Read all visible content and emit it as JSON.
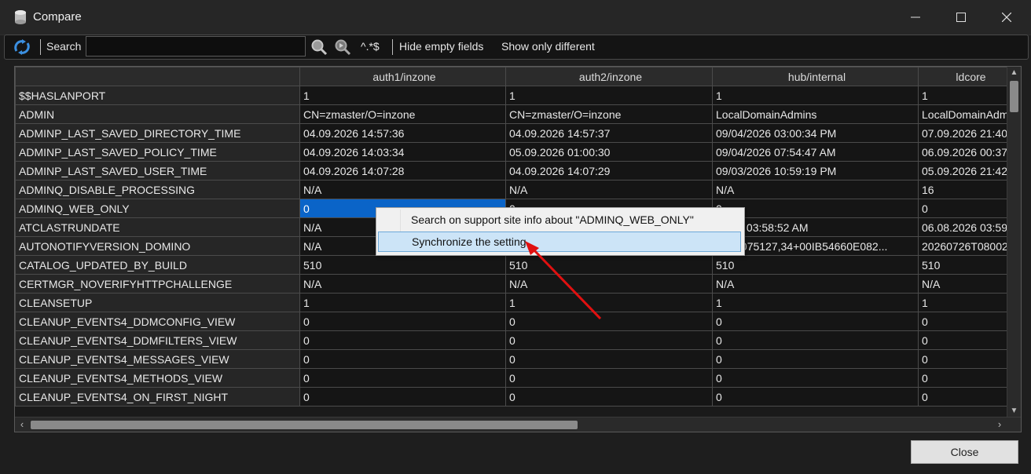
{
  "window": {
    "title": "Compare"
  },
  "toolbar": {
    "search_label": "Search",
    "search_value": "",
    "regex_label": "^.*$",
    "hide_empty_label": "Hide empty fields",
    "show_different_label": "Show only different"
  },
  "grid": {
    "columns": [
      "",
      "auth1/inzone",
      "auth2/inzone",
      "hub/internal",
      "ldcore"
    ],
    "rows": [
      [
        "$$HASLANPORT",
        "1",
        "1",
        "1",
        "1"
      ],
      [
        "ADMIN",
        "CN=zmaster/O=inzone",
        "CN=zmaster/O=inzone",
        "LocalDomainAdmins",
        "LocalDomainAdmi"
      ],
      [
        "ADMINP_LAST_SAVED_DIRECTORY_TIME",
        "04.09.2026 14:57:36",
        "04.09.2026 14:57:37",
        "09/04/2026 03:00:34 PM",
        "07.09.2026 21:40"
      ],
      [
        "ADMINP_LAST_SAVED_POLICY_TIME",
        "04.09.2026 14:03:34",
        "05.09.2026 01:00:30",
        "09/04/2026 07:54:47 AM",
        "06.09.2026 00:37"
      ],
      [
        "ADMINP_LAST_SAVED_USER_TIME",
        "04.09.2026 14:07:28",
        "04.09.2026 14:07:29",
        "09/03/2026 10:59:19 PM",
        "05.09.2026 21:42"
      ],
      [
        "ADMINQ_DISABLE_PROCESSING",
        "N/A",
        "N/A",
        "N/A",
        "16"
      ],
      [
        "ADMINQ_WEB_ONLY",
        "0",
        "0",
        "0",
        "0"
      ],
      [
        "ATCLASTRUNDATE",
        "N/A",
        "",
        "/2026 03:58:52 AM",
        "06.08.2026 03:59"
      ],
      [
        "AUTONOTIFYVERSION_DOMINO",
        "N/A",
        "",
        "726T075127,34+00IB54660E082...",
        "20260726T08002"
      ],
      [
        "CATALOG_UPDATED_BY_BUILD",
        "510",
        "510",
        "510",
        "510"
      ],
      [
        "CERTMGR_NOVERIFYHTTPCHALLENGE",
        "N/A",
        "N/A",
        "N/A",
        "N/A"
      ],
      [
        "CLEANSETUP",
        "1",
        "1",
        "1",
        "1"
      ],
      [
        "CLEANUP_EVENTS4_DDMCONFIG_VIEW",
        "0",
        "0",
        "0",
        "0"
      ],
      [
        "CLEANUP_EVENTS4_DDMFILTERS_VIEW",
        "0",
        "0",
        "0",
        "0"
      ],
      [
        "CLEANUP_EVENTS4_MESSAGES_VIEW",
        "0",
        "0",
        "0",
        "0"
      ],
      [
        "CLEANUP_EVENTS4_METHODS_VIEW",
        "0",
        "0",
        "0",
        "0"
      ],
      [
        "CLEANUP_EVENTS4_ON_FIRST_NIGHT",
        "0",
        "0",
        "0",
        "0"
      ]
    ],
    "selected_row": 6,
    "selected_col": 1
  },
  "context_menu": {
    "items": [
      "Search on support site info about \"ADMINQ_WEB_ONLY\"",
      "Synchronize the setting"
    ],
    "highlighted": 1
  },
  "footer": {
    "close_label": "Close"
  },
  "colors": {
    "selection": "#0a64c8",
    "arrow": "#e01010",
    "menu_highlight": "#cce4f7"
  }
}
